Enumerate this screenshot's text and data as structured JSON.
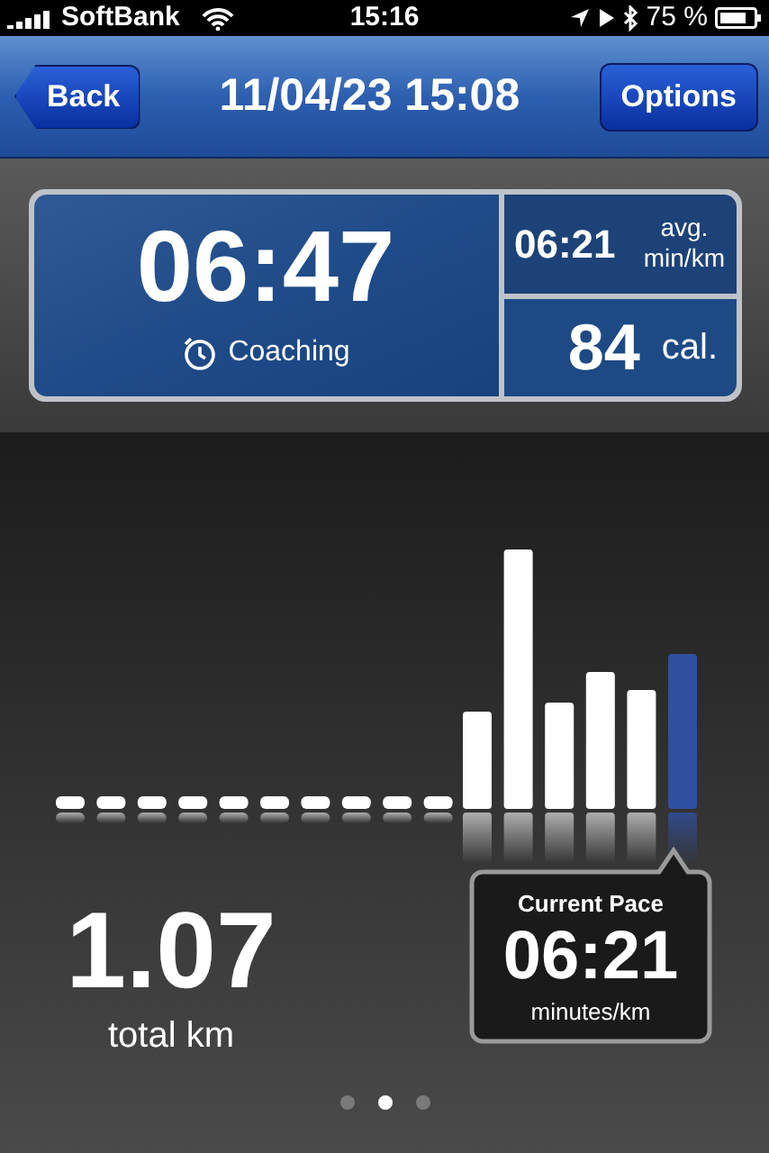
{
  "status_bar": {
    "carrier": "SoftBank",
    "time": "15:16",
    "battery": "75 %"
  },
  "nav_bar": {
    "back": "Back",
    "title": "11/04/23 15:08",
    "options": "Options"
  },
  "stats": {
    "duration": "06:47",
    "coaching": "Coaching",
    "avg_pace": "06:21",
    "avg_label": "avg.",
    "avg_unit": "min/km",
    "calories": "84",
    "calories_unit": "cal."
  },
  "distance": {
    "value": "1.07",
    "unit": "total km"
  },
  "current_pace": {
    "title": "Current Pace",
    "value": "06:21",
    "unit": "minutes/km"
  },
  "page_dots": [
    {
      "selected": false
    },
    {
      "selected": true
    },
    {
      "selected": false
    }
  ]
}
